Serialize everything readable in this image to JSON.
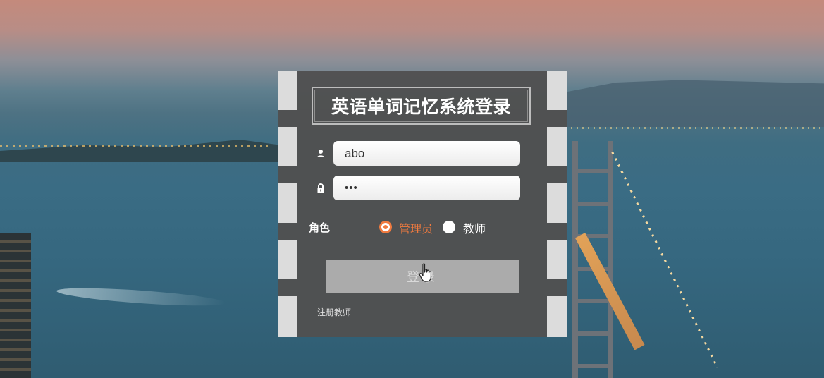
{
  "login": {
    "title": "英语单词记忆系统登录",
    "username_value": "abo",
    "password_value": "•••",
    "role_label": "角色",
    "roles": [
      {
        "label": "管理员",
        "selected": true
      },
      {
        "label": "教师",
        "selected": false
      }
    ],
    "login_button": "登录",
    "register_link": "注册教师"
  },
  "colors": {
    "accent": "#f07a3f",
    "panel": "#505050",
    "button": "#ababab"
  },
  "icons": {
    "username": "user-icon",
    "password": "lock-icon",
    "cursor": "hand-pointer-icon"
  }
}
